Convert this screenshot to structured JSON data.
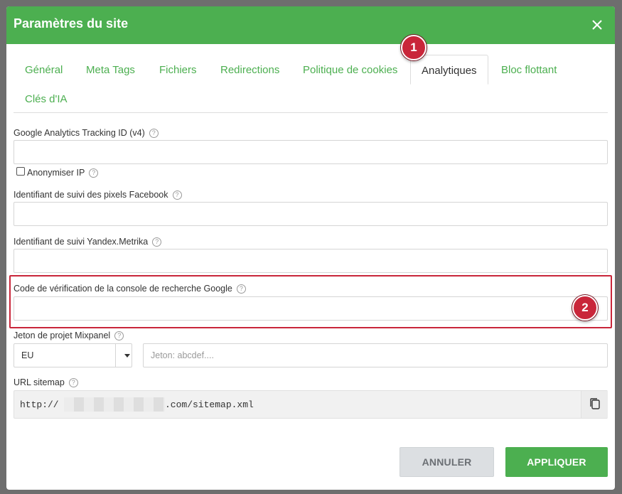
{
  "dialog": {
    "title": "Paramètres du site"
  },
  "tabs": [
    {
      "label": "Général"
    },
    {
      "label": "Meta Tags"
    },
    {
      "label": "Fichiers"
    },
    {
      "label": "Redirections"
    },
    {
      "label": "Politique de cookies"
    },
    {
      "label": "Analytiques",
      "active": true
    },
    {
      "label": "Bloc flottant"
    },
    {
      "label": "Clés d'IA"
    }
  ],
  "annotations": {
    "badge1": "1",
    "badge2": "2"
  },
  "form": {
    "ga_label": "Google Analytics Tracking ID (v4)",
    "ga_value": "",
    "anonymize_label": "Anonymiser IP",
    "anonymize_checked": false,
    "fb_label": "Identifiant de suivi des pixels Facebook",
    "fb_value": "",
    "yandex_label": "Identifiant de suivi Yandex.Metrika",
    "yandex_value": "",
    "gsc_label": "Code de vérification de la console de recherche Google",
    "gsc_value": "",
    "mixpanel_label": "Jeton de projet Mixpanel",
    "mixpanel_region": "EU",
    "mixpanel_placeholder": "Jeton: abcdef....",
    "sitemap_label": "URL sitemap",
    "sitemap_prefix": "http://",
    "sitemap_suffix": ".com/sitemap.xml"
  },
  "help_icon_glyph": "?",
  "buttons": {
    "cancel": "ANNULER",
    "apply": "APPLIQUER"
  },
  "colors": {
    "accent": "#4caf50",
    "annotation": "#c9263a"
  }
}
